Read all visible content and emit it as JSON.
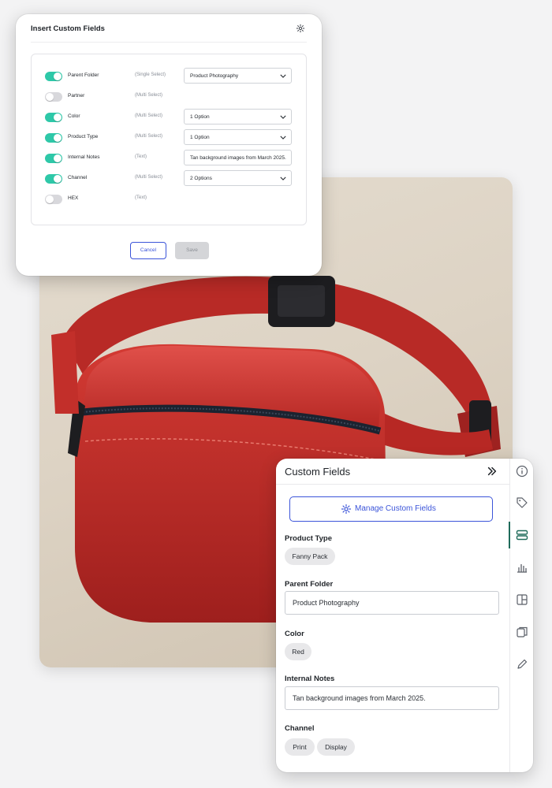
{
  "modal": {
    "title": "Insert Custom Fields",
    "icon": "gear-icon",
    "fields": [
      {
        "label": "Parent Folder",
        "type": "(Single Select)",
        "enabled": true,
        "value": "Product Photography",
        "control": "select"
      },
      {
        "label": "Partner",
        "type": "(Multi Select)",
        "enabled": false,
        "value": "",
        "control": "none"
      },
      {
        "label": "Color",
        "type": "(Multi Select)",
        "enabled": true,
        "value": "1 Option",
        "control": "select"
      },
      {
        "label": "Product Type",
        "type": "(Multi Select)",
        "enabled": true,
        "value": "1 Option",
        "control": "select"
      },
      {
        "label": "Internal Notes",
        "type": "(Text)",
        "enabled": true,
        "value": "Tan background images from March 2025.",
        "control": "text"
      },
      {
        "label": "Channel",
        "type": "(Multi Select)",
        "enabled": true,
        "value": "2 Options",
        "control": "select"
      },
      {
        "label": "HEX",
        "type": "(Text)",
        "enabled": false,
        "value": "",
        "control": "none"
      }
    ],
    "cancel_label": "Cancel",
    "save_label": "Save"
  },
  "panel": {
    "title": "Custom Fields",
    "manage_label": "Manage Custom Fields",
    "sections": {
      "product_type": {
        "label": "Product Type",
        "chips": [
          "Fanny Pack"
        ]
      },
      "parent_folder": {
        "label": "Parent Folder",
        "value": "Product Photography"
      },
      "color": {
        "label": "Color",
        "chips": [
          "Red"
        ]
      },
      "internal_notes": {
        "label": "Internal Notes",
        "value": "Tan background images from March 2025."
      },
      "channel": {
        "label": "Channel",
        "chips": [
          "Print",
          "Display"
        ]
      }
    },
    "rail_icons": [
      "info-icon",
      "tag-icon",
      "custom-fields-icon",
      "chart-icon",
      "layout-icon",
      "copy-icon",
      "pencil-icon"
    ]
  },
  "colors": {
    "accent": "#3b54d9",
    "toggle_on": "#2ec8a8",
    "product": "#c8302c"
  }
}
